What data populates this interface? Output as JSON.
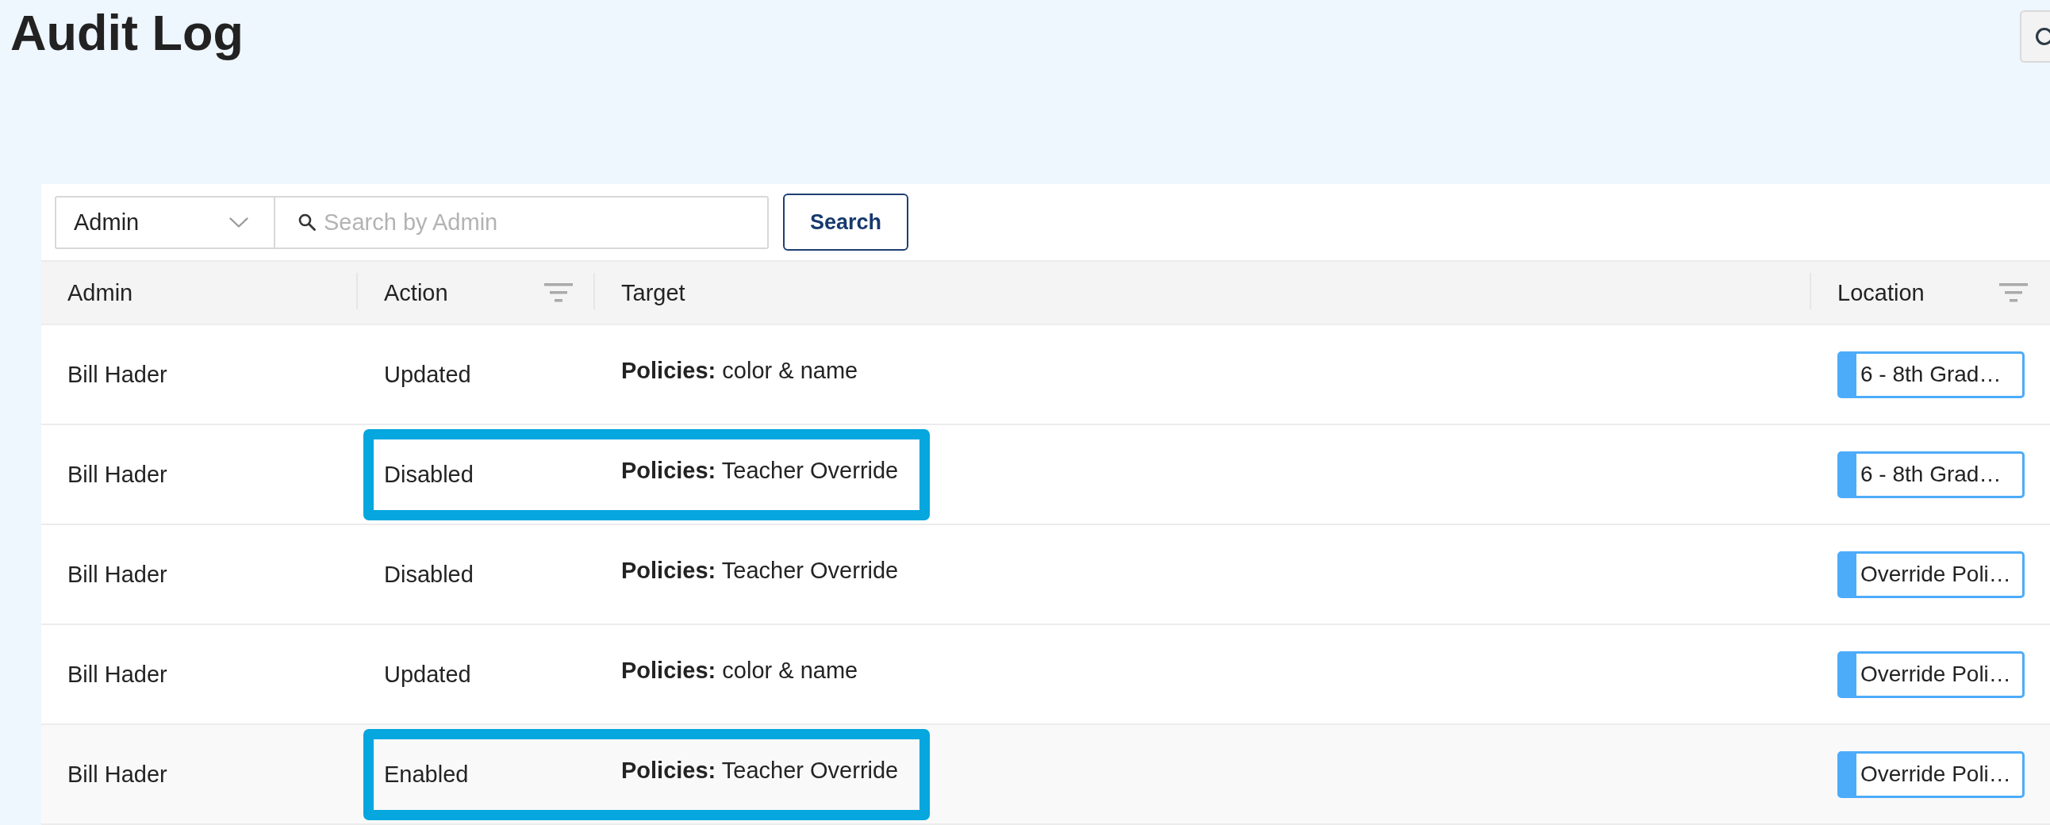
{
  "page": {
    "title": "Audit Log"
  },
  "toolbar": {
    "filter_field": {
      "value": "Admin"
    },
    "search": {
      "placeholder": "Search by Admin"
    },
    "button": "Search"
  },
  "table": {
    "columns": [
      {
        "label": "Admin",
        "filter": false
      },
      {
        "label": "Action",
        "filter": true
      },
      {
        "label": "Target",
        "filter": false
      },
      {
        "label": "Location",
        "filter": true
      }
    ],
    "rows": [
      {
        "admin": "Bill Hader",
        "action": "Updated",
        "target": "**Policies:** color & name",
        "location": "6 - 8th Grad…",
        "outlined": false,
        "highlighted": false
      },
      {
        "admin": "Bill Hader",
        "action": "Disabled",
        "target": "**Policies:** Teacher Override",
        "location": "6 - 8th Grad…",
        "outlined": true,
        "highlighted": false
      },
      {
        "admin": "Bill Hader",
        "action": "Disabled",
        "target": "**Policies:** Teacher Override",
        "location": "Override Poli…",
        "outlined": false,
        "highlighted": false
      },
      {
        "admin": "Bill Hader",
        "action": "Updated",
        "target": "**Policies:** color & name",
        "location": "Override Poli…",
        "outlined": false,
        "highlighted": false
      },
      {
        "admin": "Bill Hader",
        "action": "Enabled",
        "target": "**Policies:** Teacher Override",
        "location": "Override Poli…",
        "outlined": true,
        "highlighted": true
      }
    ]
  }
}
